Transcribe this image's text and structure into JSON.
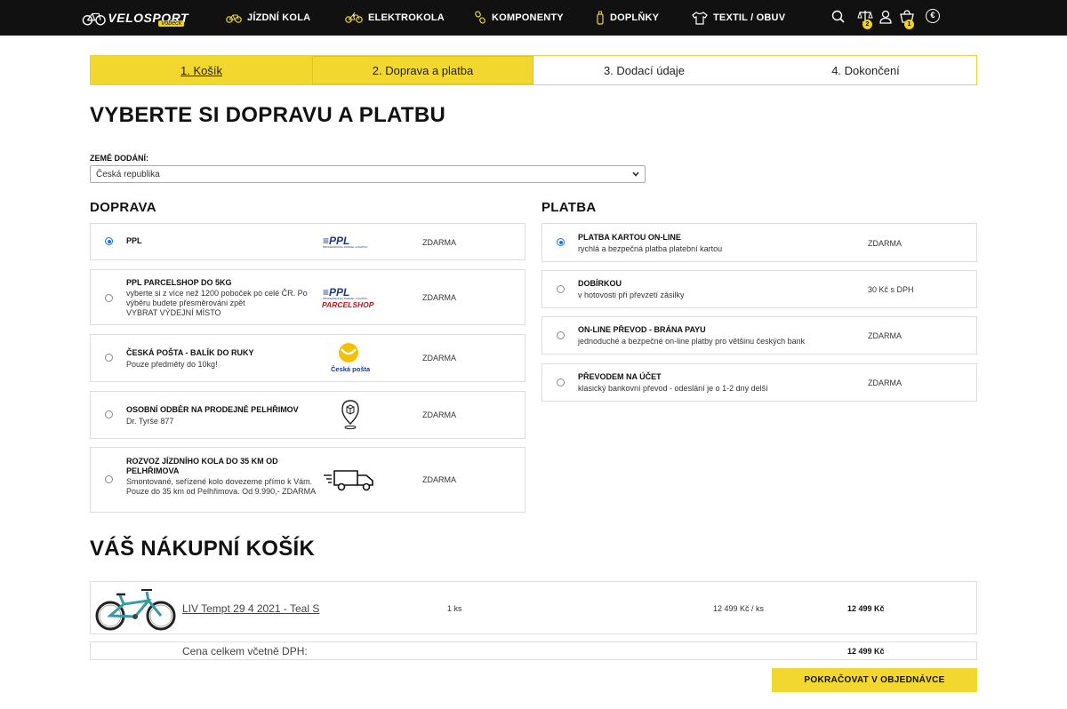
{
  "header": {
    "logo_text": "VELOSPORT",
    "logo_sub": "Vobeck",
    "nav": [
      {
        "label": "JÍZDNÍ KOLA",
        "icon": "bike-icon"
      },
      {
        "label": "ELEKTROKOLA",
        "icon": "ebike-icon"
      },
      {
        "label": "KOMPONENTY",
        "icon": "chain-icon"
      },
      {
        "label": "DOPLŇKY",
        "icon": "bottle-icon"
      },
      {
        "label": "TEXTIL / OBUV",
        "icon": "shirt-icon"
      }
    ],
    "compare_badge": "2",
    "cart_badge": "1",
    "currency_icon": "€"
  },
  "steps": [
    {
      "label": "1. Košík",
      "state": "done"
    },
    {
      "label": "2. Doprava a platba",
      "state": "active"
    },
    {
      "label": "3. Dodací údaje",
      "state": "pending"
    },
    {
      "label": "4. Dokončení",
      "state": "pending"
    }
  ],
  "page_title": "VYBERTE SI DOPRAVU A PLATBU",
  "country": {
    "label": "ZEMĚ DODÁNÍ:",
    "selected": "Česká republika"
  },
  "shipping": {
    "heading": "DOPRAVA",
    "options": [
      {
        "name": "PPL",
        "desc": "",
        "price": "ZDARMA",
        "selected": true,
        "logo": "ppl-logo"
      },
      {
        "name": "PPL PARCELSHOP DO 5KG",
        "desc": "vyberte si z více než 1200 poboček po celé ČR. Po výběru budete přesměrováni zpět",
        "extra": "VYBRAT VÝDEJNÍ MÍSTO",
        "price": "ZDARMA",
        "selected": false,
        "logo": "ppl-parcelshop-logo"
      },
      {
        "name": "ČESKÁ POŠTA - BALÍK DO RUKY",
        "desc": "Pouze předměty do 10kg!",
        "price": "ZDARMA",
        "selected": false,
        "logo": "ceska-posta-logo"
      },
      {
        "name": "OSOBNÍ ODBĚR NA PRODEJNĚ PELHŘIMOV",
        "desc": "Dr. Tyrše 877",
        "price": "ZDARMA",
        "selected": false,
        "logo": "map-pin-icon"
      },
      {
        "name": "ROZVOZ JÍZDNÍHO KOLA DO 35 KM OD PELHŘIMOVA",
        "desc": "Smontované, seřízené kolo dovezeme přímo k Vám. Pouze do 35 km od Pelhřimova. Od 9.990,- ZDARMA",
        "price": "ZDARMA",
        "selected": false,
        "logo": "delivery-truck-icon"
      }
    ]
  },
  "payment": {
    "heading": "PLATBA",
    "options": [
      {
        "name": "PLATBA KARTOU ON-LINE",
        "desc": "rychlá a bezpečná platba platební kartou",
        "price": "ZDARMA",
        "selected": true
      },
      {
        "name": "DOBÍRKOU",
        "desc": "v hotovosti při převzetí zásilky",
        "price": "30 Kč s DPH",
        "selected": false
      },
      {
        "name": "ON-LINE PŘEVOD - BRÁNA PAYU",
        "desc": "jednoduché a bezpečné on-line platby pro většinu českých bank",
        "price": "ZDARMA",
        "selected": false
      },
      {
        "name": "PŘEVODEM NA ÚČET",
        "desc": "klasický bankovní převod - odeslání je o 1-2 dny delší",
        "price": "ZDARMA",
        "selected": false
      }
    ]
  },
  "cart": {
    "heading": "VÁŠ NÁKUPNÍ KOŠÍK",
    "item": {
      "name": "LIV Tempt 29 4 2021 - Teal S",
      "qty": "1 ks",
      "unit_price": "12 499 Kč / ks",
      "total": "12 499 Kč"
    },
    "total_label": "Cena celkem včetně DPH:",
    "total_value": "12 499 Kč",
    "continue_label": "POKRAČOVAT V OBJEDNÁVCE"
  },
  "colors": {
    "accent": "#f1d72e",
    "navbar": "#111111",
    "radio": "#1a73e8"
  }
}
